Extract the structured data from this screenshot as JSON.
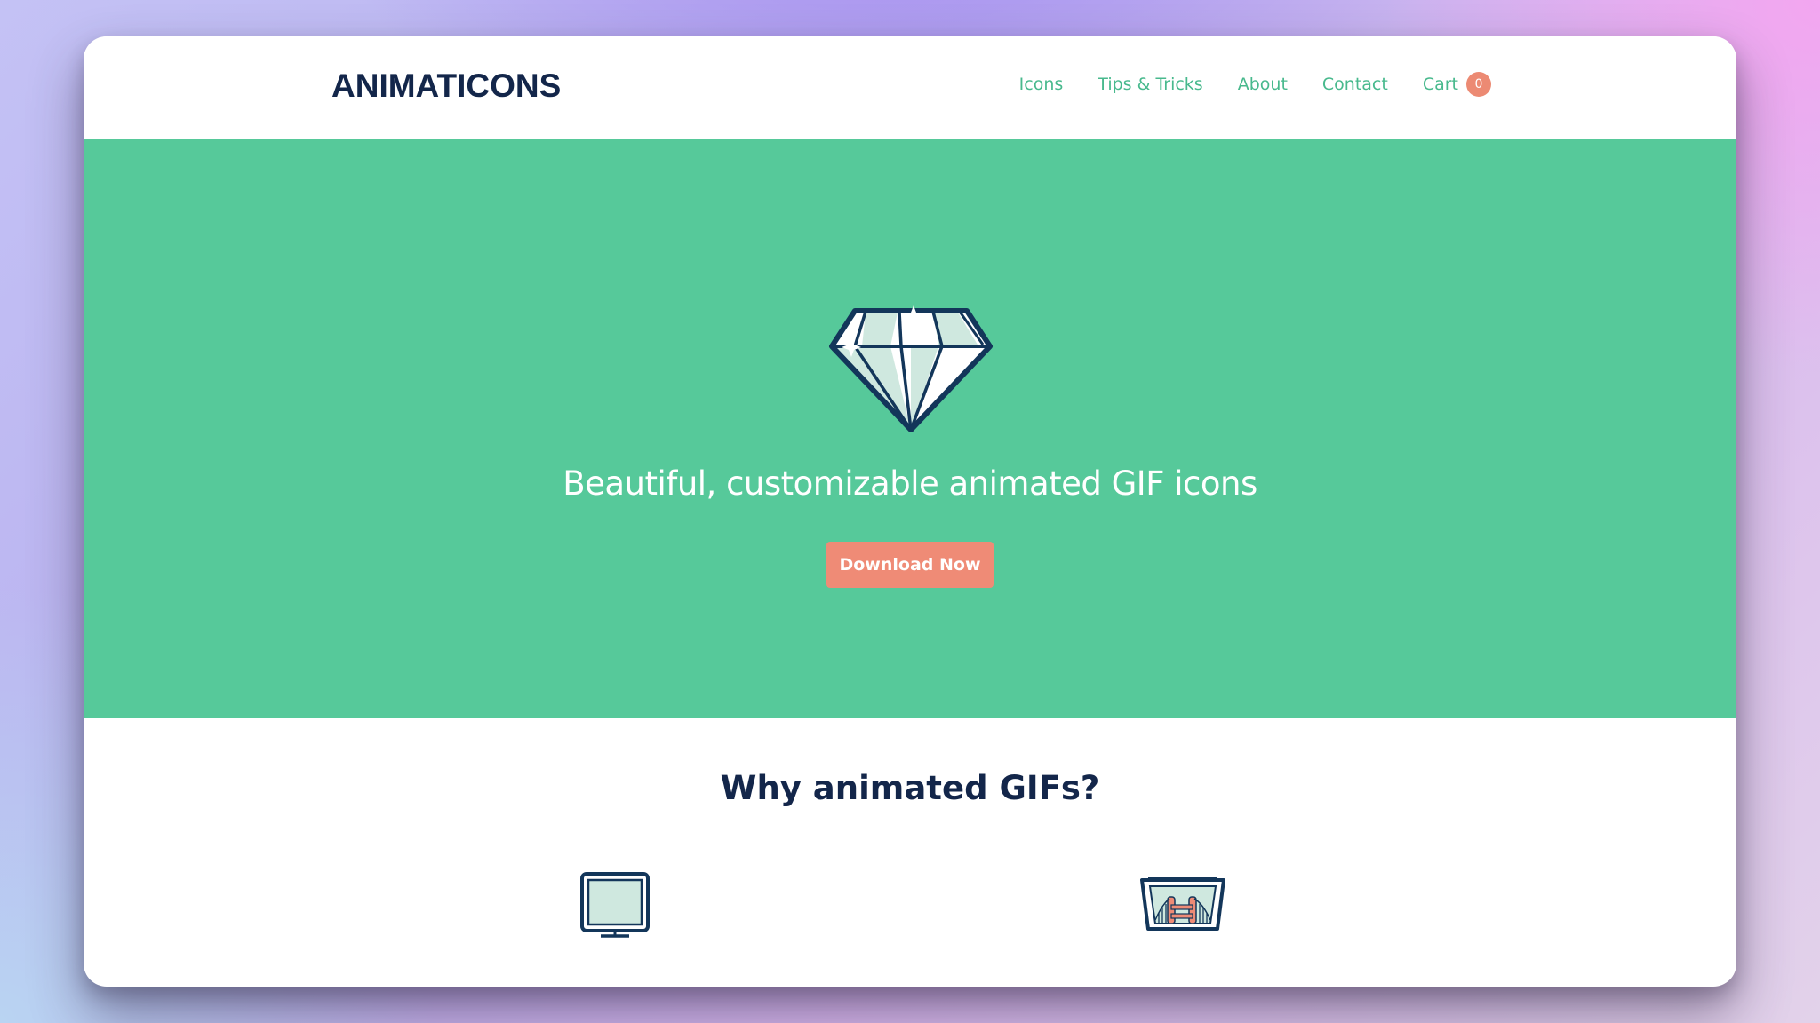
{
  "header": {
    "logo": "ANIMATICONS",
    "nav": [
      {
        "label": "Icons"
      },
      {
        "label": "Tips & Tricks"
      },
      {
        "label": "About"
      },
      {
        "label": "Contact"
      }
    ],
    "cart": {
      "label": "Cart",
      "count": "0"
    }
  },
  "hero": {
    "icon": "diamond-icon",
    "tagline": "Beautiful, customizable animated GIF icons",
    "cta_label": "Download Now"
  },
  "features": {
    "title": "Why animated GIFs?",
    "icons": [
      "monitor-icon",
      "bridge-picture-icon"
    ]
  },
  "colors": {
    "brand_green": "#56c99a",
    "nav_green": "#48b98d",
    "accent_salmon": "#ef8b76",
    "navy": "#13264a"
  }
}
